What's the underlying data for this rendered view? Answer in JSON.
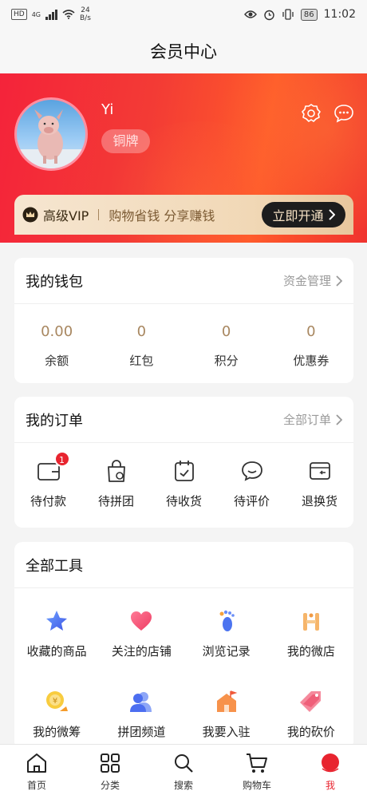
{
  "status_bar": {
    "hd": "HD",
    "net": "4G",
    "speed_value": "24",
    "speed_unit": "B/s",
    "battery": "86",
    "time": "11:02"
  },
  "header": {
    "title": "会员中心"
  },
  "profile": {
    "username": "Yi",
    "level": "铜牌"
  },
  "vip": {
    "title": "高级VIP",
    "slogan": "购物省钱 分享赚钱",
    "button": "立即开通"
  },
  "wallet": {
    "title": "我的钱包",
    "link": "资金管理",
    "items": [
      {
        "value": "0.00",
        "label": "余额"
      },
      {
        "value": "0",
        "label": "红包"
      },
      {
        "value": "0",
        "label": "积分"
      },
      {
        "value": "0",
        "label": "优惠券"
      }
    ]
  },
  "orders": {
    "title": "我的订单",
    "link": "全部订单",
    "items": [
      {
        "label": "待付款",
        "badge": "1",
        "icon": "wallet-icon"
      },
      {
        "label": "待拼团",
        "icon": "group-bag-icon"
      },
      {
        "label": "待收货",
        "icon": "receive-box-icon"
      },
      {
        "label": "待评价",
        "icon": "comment-icon"
      },
      {
        "label": "退换货",
        "icon": "return-icon"
      }
    ]
  },
  "tools": {
    "title": "全部工具",
    "items": [
      {
        "label": "收藏的商品",
        "icon": "star-icon"
      },
      {
        "label": "关注的店铺",
        "icon": "heart-icon"
      },
      {
        "label": "浏览记录",
        "icon": "footprint-icon"
      },
      {
        "label": "我的微店",
        "icon": "shop-h-icon"
      },
      {
        "label": "我的微筹",
        "icon": "coin-icon"
      },
      {
        "label": "拼团频道",
        "icon": "users-icon"
      },
      {
        "label": "我要入驻",
        "icon": "house-flag-icon"
      },
      {
        "label": "我的砍价",
        "icon": "tag-icon"
      }
    ]
  },
  "bottom_nav": [
    {
      "label": "首页",
      "icon": "home-icon"
    },
    {
      "label": "分类",
      "icon": "category-icon"
    },
    {
      "label": "搜索",
      "icon": "search-icon"
    },
    {
      "label": "购物车",
      "icon": "cart-icon"
    },
    {
      "label": "我",
      "icon": "profile-dot-icon",
      "active": true
    }
  ],
  "colors": {
    "brand_red": "#e8242f",
    "gold_text": "#a88760"
  }
}
